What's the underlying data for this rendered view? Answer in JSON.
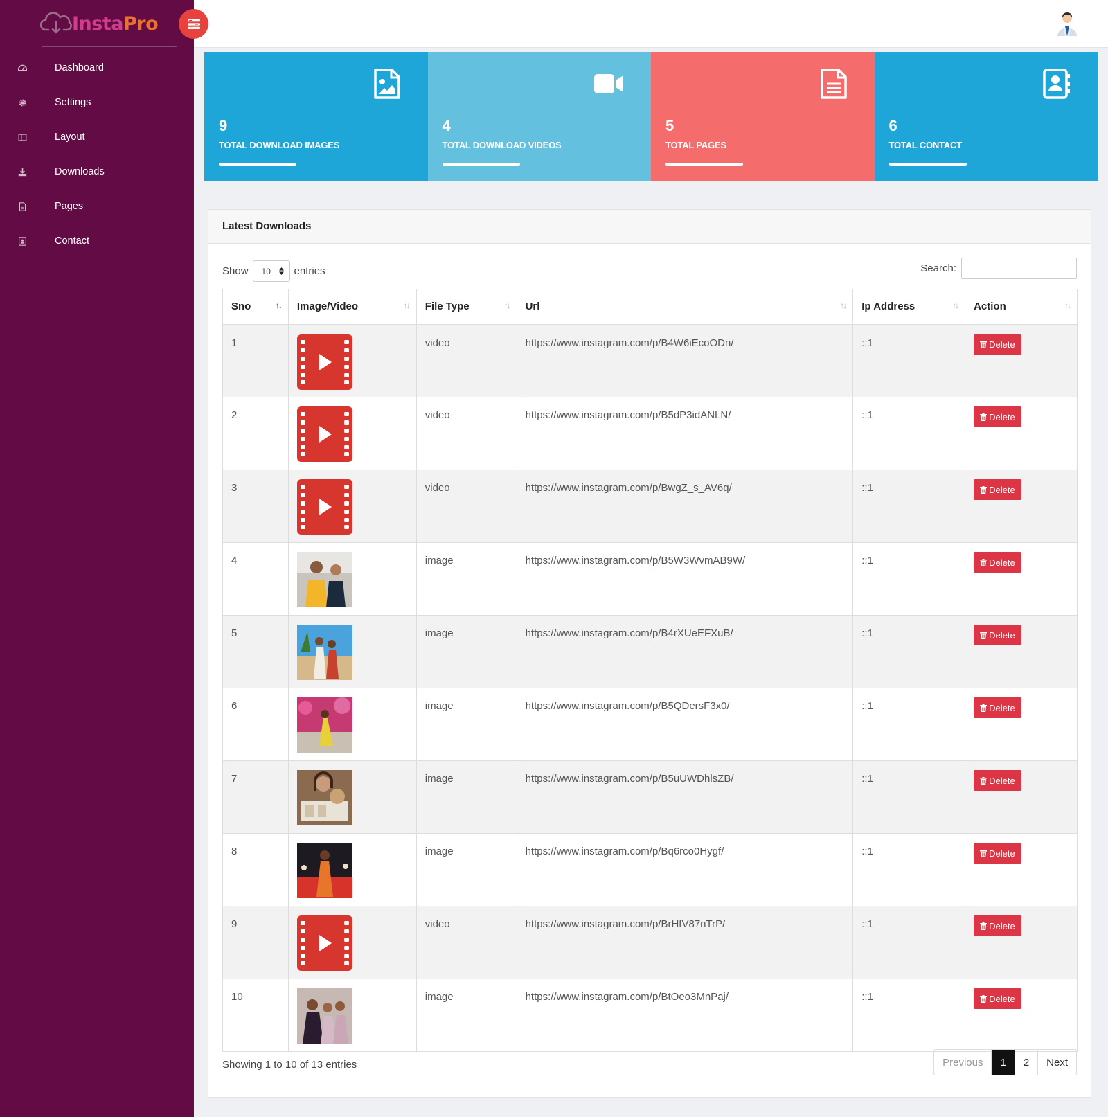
{
  "brand": {
    "insta": "Insta",
    "pro": "Pro"
  },
  "colors": {
    "sidebar": "#620b44",
    "card_blue": "#1fa6d9",
    "card_lightblue": "#63c0de",
    "card_coral": "#f46c6b",
    "danger": "#dc3545"
  },
  "sidebar": {
    "items": [
      {
        "label": "Dashboard",
        "icon": "dashboard-icon"
      },
      {
        "label": "Settings",
        "icon": "gear-icon"
      },
      {
        "label": "Layout",
        "icon": "layout-icon"
      },
      {
        "label": "Downloads",
        "icon": "download-icon"
      },
      {
        "label": "Pages",
        "icon": "file-icon"
      },
      {
        "label": "Contact",
        "icon": "contact-icon"
      }
    ]
  },
  "stats": [
    {
      "value": "9",
      "label": "TOTAL DOWNLOAD IMAGES",
      "icon": "image-file-icon"
    },
    {
      "value": "4",
      "label": "TOTAL DOWNLOAD VIDEOS",
      "icon": "video-camera-icon"
    },
    {
      "value": "5",
      "label": "TOTAL PAGES",
      "icon": "document-icon"
    },
    {
      "value": "6",
      "label": "TOTAL CONTACT",
      "icon": "address-book-icon"
    }
  ],
  "panel": {
    "title": "Latest Downloads",
    "show_label": "Show",
    "entries_label": "entries",
    "page_length": "10",
    "search_label": "Search:",
    "search_value": ""
  },
  "table": {
    "columns": [
      "Sno",
      "Image/Video",
      "File Type",
      "Url",
      "Ip Address",
      "Action"
    ],
    "delete_label": "Delete",
    "rows": [
      {
        "sno": "1",
        "type": "video",
        "url": "https://www.instagram.com/p/B4W6iEcoODn/",
        "ip": "::1",
        "thumb": "video-thumbnail"
      },
      {
        "sno": "2",
        "type": "video",
        "url": "https://www.instagram.com/p/B5dP3idANLN/",
        "ip": "::1",
        "thumb": "video-thumbnail"
      },
      {
        "sno": "3",
        "type": "video",
        "url": "https://www.instagram.com/p/BwgZ_s_AV6q/",
        "ip": "::1",
        "thumb": "video-thumbnail"
      },
      {
        "sno": "4",
        "type": "image",
        "url": "https://www.instagram.com/p/B5W3WvmAB9W/",
        "ip": "::1",
        "thumb": "photo-two-men"
      },
      {
        "sno": "5",
        "type": "image",
        "url": "https://www.instagram.com/p/B4rXUeEFXuB/",
        "ip": "::1",
        "thumb": "photo-couple-beach"
      },
      {
        "sno": "6",
        "type": "image",
        "url": "https://www.instagram.com/p/B5QDersF3x0/",
        "ip": "::1",
        "thumb": "photo-woman-flowers"
      },
      {
        "sno": "7",
        "type": "image",
        "url": "https://www.instagram.com/p/B5uUWDhlsZB/",
        "ip": "::1",
        "thumb": "photo-woman-box"
      },
      {
        "sno": "8",
        "type": "image",
        "url": "https://www.instagram.com/p/Bq6rco0Hygf/",
        "ip": "::1",
        "thumb": "photo-woman-saree"
      },
      {
        "sno": "9",
        "type": "video",
        "url": "https://www.instagram.com/p/BrHfV87nTrP/",
        "ip": "::1",
        "thumb": "video-thumbnail"
      },
      {
        "sno": "10",
        "type": "image",
        "url": "https://www.instagram.com/p/BtOeo3MnPaj/",
        "ip": "::1",
        "thumb": "photo-group"
      }
    ]
  },
  "footer": {
    "info": "Showing 1 to 10 of 13 entries",
    "previous": "Previous",
    "pages": [
      "1",
      "2"
    ],
    "next": "Next"
  }
}
